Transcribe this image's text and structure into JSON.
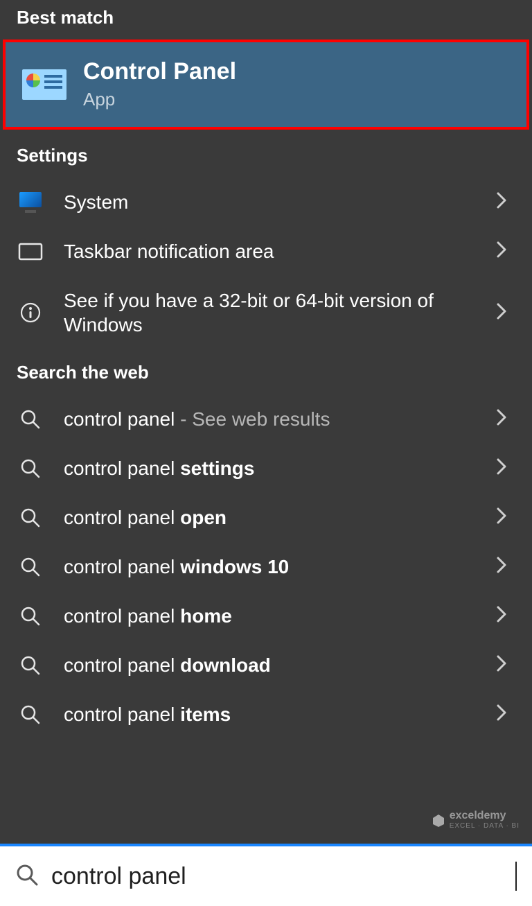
{
  "sections": {
    "best_match_header": "Best match",
    "settings_header": "Settings",
    "web_header": "Search the web"
  },
  "best_match": {
    "title": "Control Panel",
    "subtitle": "App"
  },
  "settings_items": [
    {
      "icon": "system",
      "label": "System"
    },
    {
      "icon": "taskbar",
      "label": "Taskbar notification area"
    },
    {
      "icon": "info",
      "label": "See if you have a 32-bit or 64-bit version of Windows"
    }
  ],
  "web_items": [
    {
      "prefix": "control panel",
      "suffix": "",
      "hint": "See web results"
    },
    {
      "prefix": "control panel ",
      "suffix": "settings",
      "hint": ""
    },
    {
      "prefix": "control panel ",
      "suffix": "open",
      "hint": ""
    },
    {
      "prefix": "control panel ",
      "suffix": "windows 10",
      "hint": ""
    },
    {
      "prefix": "control panel ",
      "suffix": "home",
      "hint": ""
    },
    {
      "prefix": "control panel ",
      "suffix": "download",
      "hint": ""
    },
    {
      "prefix": "control panel ",
      "suffix": "items",
      "hint": ""
    }
  ],
  "search": {
    "query": "control panel"
  },
  "watermark": {
    "brand": "exceldemy",
    "tag": "EXCEL · DATA · BI"
  },
  "colors": {
    "highlight_bg": "#3b6585",
    "highlight_border": "#ff0000",
    "searchbar_accent": "#1a86ff"
  }
}
